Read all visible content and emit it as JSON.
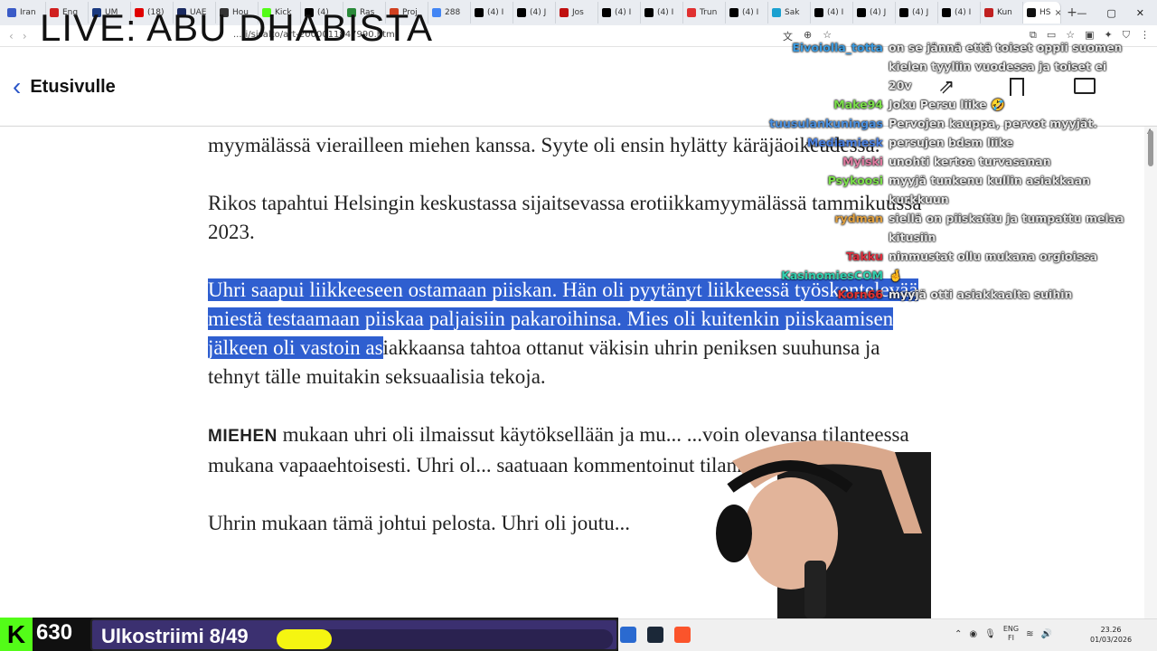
{
  "stream": {
    "live_title": "LIVE: ABU DHABISTA",
    "kick_logo": "K",
    "viewer_count": "630",
    "goal_label": "Ulkostriimi 8/49",
    "goal_progress": 0.163
  },
  "browser": {
    "tabs": [
      {
        "label": "Iran",
        "color": "#3a5bc7"
      },
      {
        "label": "Eng",
        "color": "#d02020"
      },
      {
        "label": "UM",
        "color": "#1a3a80"
      },
      {
        "label": "(18)",
        "color": "#e00000"
      },
      {
        "label": "UAE",
        "color": "#1a2a60"
      },
      {
        "label": "Hou",
        "color": "#333333"
      },
      {
        "label": "Kick",
        "color": "#53fc18"
      },
      {
        "label": "(4)",
        "color": "#000000"
      },
      {
        "label": "Ras",
        "color": "#2a8a3a"
      },
      {
        "label": "Proj",
        "color": "#d04020"
      },
      {
        "label": "288",
        "color": "#4285f4"
      },
      {
        "label": "(4) I",
        "color": "#000000"
      },
      {
        "label": "(4) J",
        "color": "#000000"
      },
      {
        "label": "Jos",
        "color": "#c01010"
      },
      {
        "label": "(4) I",
        "color": "#000000"
      },
      {
        "label": "(4) I",
        "color": "#000000"
      },
      {
        "label": "Trun",
        "color": "#e03030"
      },
      {
        "label": "(4) I",
        "color": "#000000"
      },
      {
        "label": "Sak",
        "color": "#1aa0d0"
      },
      {
        "label": "(4) I",
        "color": "#000000"
      },
      {
        "label": "(4) J",
        "color": "#000000"
      },
      {
        "label": "(4) J",
        "color": "#000000"
      },
      {
        "label": "(4) I",
        "color": "#000000"
      },
      {
        "label": "Kun",
        "color": "#c02020"
      },
      {
        "label": "HS",
        "color": "#111111",
        "active": true
      }
    ],
    "url": "...ti/sisalto/art-2000011847990.html",
    "clock_time": "23.26",
    "clock_date": "01/03/2026",
    "lang_top": "ENG",
    "lang_bottom": "FI"
  },
  "site_header": {
    "back_label": "Etusivulle"
  },
  "article": {
    "p1": "myymälässä vierailleen miehen kanssa. Syyte oli ensin hylätty käräjäoikeudessa.",
    "p2": "Rikos tapahtui Helsingin keskustassa sijaitsevassa erotiikkamyymälässä tammikuussa 2023.",
    "p3_selected": "Uhri saapui liikkeeseen ostamaan piiskan. Hän oli pyytänyt liikkeessä työskentelevää miestä testaamaan piiskaa paljaisiin pakaroihinsa. Mies oli kuitenkin piiskaamisen jälkeen oli vastoin as",
    "p3_rest": "iakkaansa tahtoa ottanut väkisin uhrin peniksen suuhunsa ja tehnyt tälle muitakin seksuaalisia tekoja.",
    "p4_lead": "MIEHEN",
    "p4": " mukaan uhri oli ilmaissut käytöksellään ja mu... ...voin olevansa tilanteessa mukana vapaaehtoisesti. Uhri ol... saatuaan kommentoinut tilannetta jännittäväksi.",
    "p5": "Uhrin mukaan tämä johtui pelosta. Uhri oli joutu..."
  },
  "chat": [
    {
      "user": "Eivoiolla_totta",
      "color": "#3a9be0",
      "text": "on se jännä että toiset oppii suomen kielen tyyliin vuodessa ja toiset ei 20v"
    },
    {
      "user": "Make94",
      "color": "#7be04a",
      "text": "Joku Persu liike 🤣"
    },
    {
      "user": "tuusulankuningas",
      "color": "#4a90e0",
      "text": "Pervojen kauppa, pervot myyjät."
    },
    {
      "user": "Mediamiesk",
      "color": "#4a80e0",
      "text": "persujen bdsm liike"
    },
    {
      "user": "Myiski",
      "color": "#e07aa0",
      "text": "unohti kertoa turvasanan"
    },
    {
      "user": "Psykoosi",
      "color": "#7be04a",
      "text": "myyjä tunkenu kullin asiakkaan kurkkuun"
    },
    {
      "user": "rydman",
      "color": "#e0a040",
      "text": "siellä on piiskattu ja tumpattu melaa kitusiin"
    },
    {
      "user": "Takku",
      "color": "#e03040",
      "text": "ninmustat ollu mukana orgioissa"
    },
    {
      "user": "KasinomiesCOM",
      "color": "#30d0b0",
      "text": "🤞"
    },
    {
      "user": "Korn66",
      "color": "#e03030",
      "text": "myyjä otti asiakkaalta suihin"
    }
  ]
}
